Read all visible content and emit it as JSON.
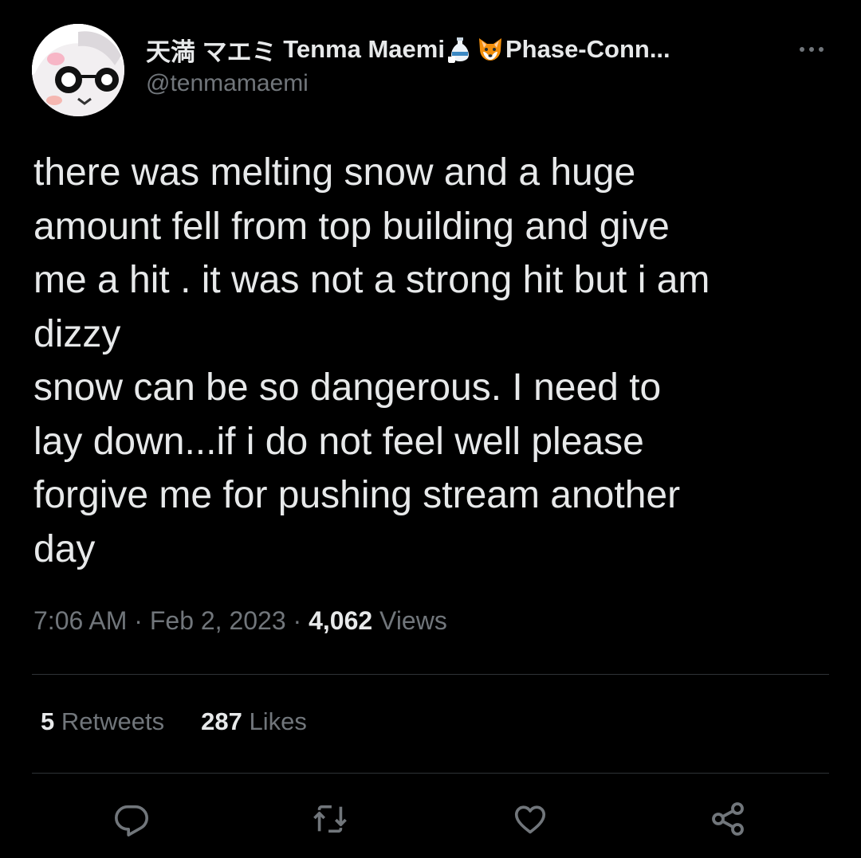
{
  "author": {
    "display_name_jp": "天満 マエミ",
    "display_name_en": "Tenma Maemi",
    "display_name_tail": "Phase-Conn...",
    "emojis": [
      "sake-emoji",
      "fox-emoji"
    ],
    "handle": "@tenmamaemi"
  },
  "tweet": {
    "text": "there was melting snow and a huge\namount fell from top building and give\nme a hit . it was not a strong hit but i am\ndizzy\nsnow can be so dangerous. I need to\nlay down...if i do not feel well please\nforgive me for pushing stream another\nday",
    "time": "7:06 AM",
    "date": "Feb 2, 2023",
    "separator": "·",
    "view_count": "4,062",
    "views_label": "Views"
  },
  "stats": {
    "retweets_count": "5",
    "retweets_label": "Retweets",
    "likes_count": "287",
    "likes_label": "Likes"
  },
  "actions": [
    "reply-icon",
    "retweet-icon",
    "like-icon",
    "share-icon"
  ],
  "colors": {
    "background": "#000000",
    "primary_text": "#e7e9ea",
    "secondary_text": "#71767b",
    "divider": "#2f3336"
  }
}
